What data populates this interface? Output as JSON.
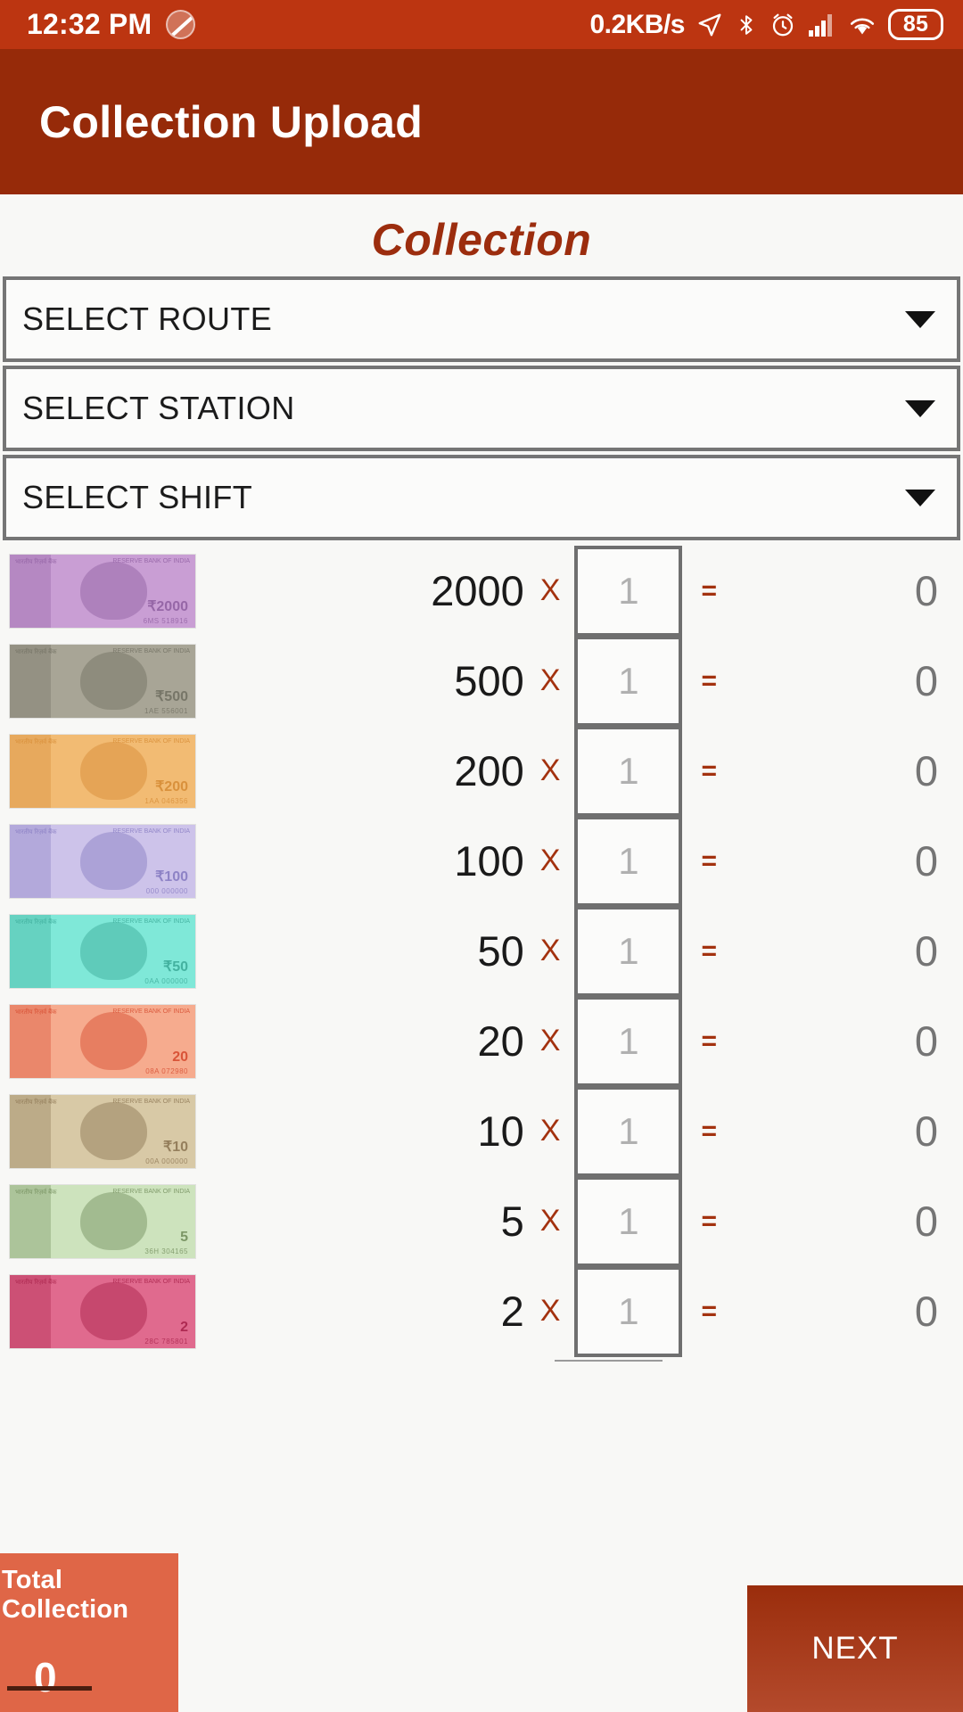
{
  "status_bar": {
    "time": "12:32 PM",
    "mute_icon": "mute-icon",
    "network_speed": "0.2KB/s",
    "icons": [
      "location-arrow-icon",
      "bluetooth-icon",
      "alarm-icon",
      "signal-bars-icon",
      "wifi-icon"
    ],
    "battery_level": "85",
    "background_color": "#bc3511"
  },
  "app_bar": {
    "title": "Collection Upload",
    "background_color": "#962a09"
  },
  "page": {
    "heading": "Collection",
    "heading_color": "#9c2d0e",
    "background_color": "#f8f8f6"
  },
  "spinners": [
    {
      "label": "SELECT ROUTE",
      "icon": "chevron-down-icon"
    },
    {
      "label": "SELECT STATION",
      "icon": "chevron-down-icon"
    },
    {
      "label": "SELECT SHIFT",
      "icon": "chevron-down-icon"
    }
  ],
  "denominations": {
    "multiply_symbol": "X",
    "equals_symbol": "=",
    "qty_placeholder": "1",
    "rows": [
      {
        "value": "2000",
        "qty": "",
        "result": "0",
        "note_icon": "note-2000-icon",
        "note_color": "#c99ed4",
        "note_accent": "#8e5ea0",
        "header_left": "भारतीय रिज़र्व बैंक",
        "header_right": "RESERVE BANK OF INDIA",
        "serial": "6MS 518916",
        "mark": "₹2000"
      },
      {
        "value": "500",
        "qty": "",
        "result": "0",
        "note_icon": "note-500-icon",
        "note_color": "#a8a596",
        "note_accent": "#6f6e60",
        "header_left": "भारतीय रिज़र्व बैंक",
        "header_right": "RESERVE BANK OF INDIA",
        "serial": "1AE 556001",
        "mark": "₹500"
      },
      {
        "value": "200",
        "qty": "",
        "result": "0",
        "note_icon": "note-200-icon",
        "note_color": "#f2bb73",
        "note_accent": "#d58a33",
        "header_left": "भारतीय रिज़र्व बैंक",
        "header_right": "RESERVE BANK OF INDIA",
        "serial": "1AA 046356",
        "mark": "₹200"
      },
      {
        "value": "100",
        "qty": "",
        "result": "0",
        "note_icon": "note-100-icon",
        "note_color": "#cdc3ea",
        "note_accent": "#8479c0",
        "header_left": "भारतीय रिज़र्व बैंक",
        "header_right": "RESERVE BANK OF INDIA",
        "serial": "000 000000",
        "mark": "₹100"
      },
      {
        "value": "50",
        "qty": "",
        "result": "0",
        "note_icon": "note-50-icon",
        "note_color": "#7fe8d8",
        "note_accent": "#3aa997",
        "header_left": "भारतीय रिज़र्व बैंक",
        "header_right": "RESERVE BANK OF INDIA",
        "serial": "0AA 000000",
        "mark": "₹50"
      },
      {
        "value": "20",
        "qty": "",
        "result": "0",
        "note_icon": "note-20-icon",
        "note_color": "#f6ab8e",
        "note_accent": "#d4462a",
        "header_left": "भारतीय रिज़र्व बैंक",
        "header_right": "RESERVE BANK OF INDIA",
        "serial": "08A 072980",
        "mark": "20"
      },
      {
        "value": "10",
        "qty": "",
        "result": "0",
        "note_icon": "note-10-icon",
        "note_color": "#d8c9a6",
        "note_accent": "#8a7350",
        "header_left": "भारतीय रिज़र्व बैंक",
        "header_right": "RESERVE BANK OF INDIA",
        "serial": "00A 000000",
        "mark": "₹10"
      },
      {
        "value": "5",
        "qty": "",
        "result": "0",
        "note_icon": "note-5-icon",
        "note_color": "#cde3bd",
        "note_accent": "#6f8a58",
        "header_left": "भारतीय रिज़र्व बैंक",
        "header_right": "RESERVE BANK OF INDIA",
        "serial": "36H 304165",
        "mark": "5"
      },
      {
        "value": "2",
        "qty": "",
        "result": "0",
        "note_icon": "note-2-icon",
        "note_color": "#e06a8e",
        "note_accent": "#a62048",
        "header_left": "भारतीय रिज़र्व बैंक",
        "header_right": "RESERVE BANK OF INDIA",
        "serial": "28C 785801",
        "mark": "2"
      }
    ]
  },
  "bottom_bar": {
    "total_label": "Total Collection",
    "total_value": "0",
    "total_background": "#df6647",
    "next_label": "NEXT",
    "next_background": "#9a2d0c"
  }
}
